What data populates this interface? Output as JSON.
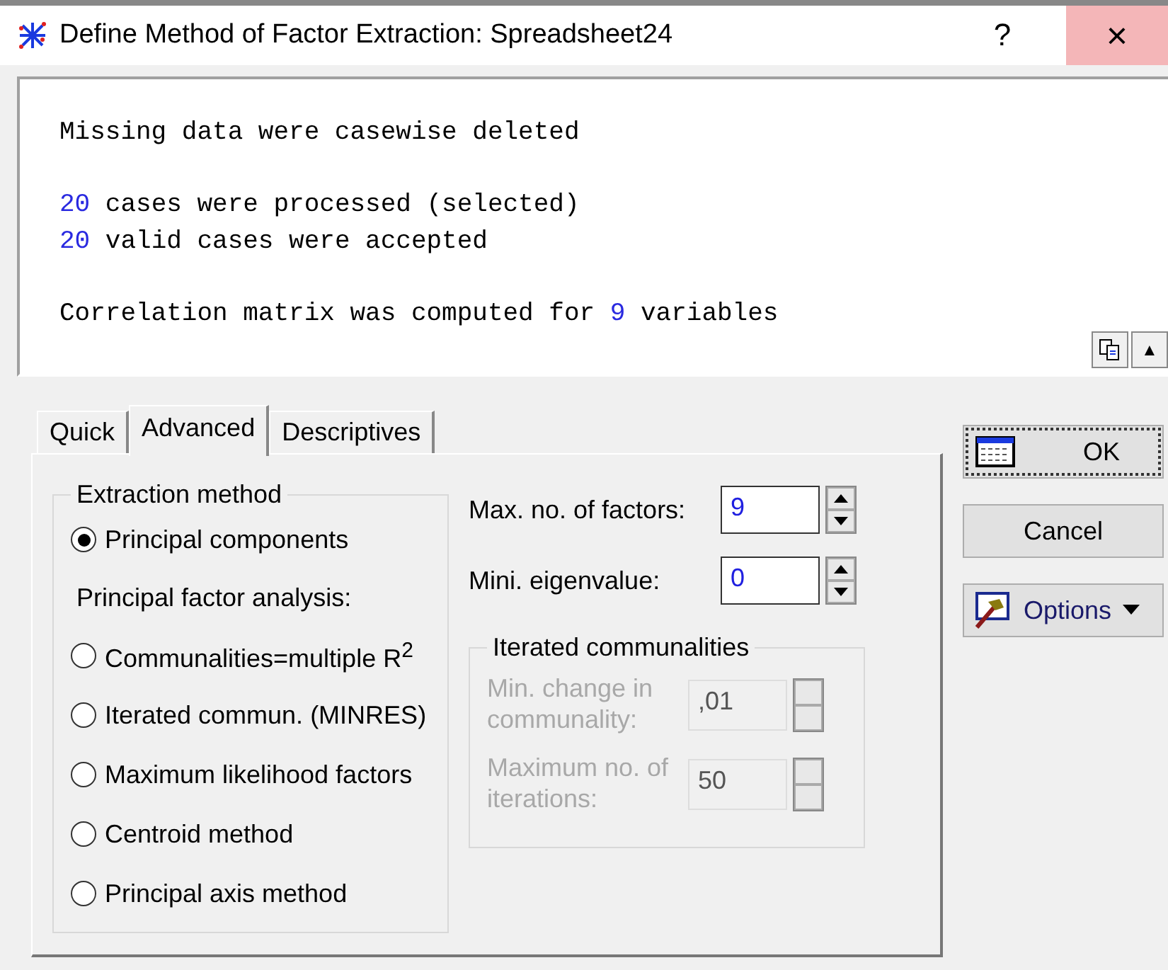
{
  "window": {
    "title": "Define Method of Factor Extraction: Spreadsheet24",
    "help": "?",
    "close": "×"
  },
  "output": {
    "lines": [
      {
        "kind": "text",
        "segments": [
          {
            "kind": "text",
            "text": "Missing data were casewise deleted"
          }
        ]
      },
      {
        "kind": "blank"
      },
      {
        "kind": "text",
        "segments": [
          {
            "kind": "number",
            "text": "20"
          },
          {
            "kind": "text",
            "text": " cases were processed (selected)"
          }
        ]
      },
      {
        "kind": "text",
        "segments": [
          {
            "kind": "number",
            "text": "20"
          },
          {
            "kind": "text",
            "text": " valid cases were accepted"
          }
        ]
      },
      {
        "kind": "blank"
      },
      {
        "kind": "text",
        "segments": [
          {
            "kind": "text",
            "text": "Correlation matrix was computed for "
          },
          {
            "kind": "number",
            "text": "9"
          },
          {
            "kind": "text",
            "text": " variables"
          }
        ]
      }
    ],
    "collapse": "▲"
  },
  "tabs": [
    {
      "label": "Quick",
      "selected": false
    },
    {
      "label": "Advanced",
      "selected": true
    },
    {
      "label": "Descriptives",
      "selected": false
    }
  ],
  "extraction": {
    "title": "Extraction method",
    "options": [
      {
        "kind": "radio",
        "label": "Principal components",
        "selected": true
      },
      {
        "kind": "heading",
        "label": "Principal factor analysis:"
      },
      {
        "kind": "radio",
        "label": "Communalities=multiple R$^{2}$",
        "selected": false
      },
      {
        "kind": "radio",
        "label": "Iterated commun. (MINRES)",
        "selected": false
      },
      {
        "kind": "radio",
        "label": "Maximum likelihood factors",
        "selected": false
      },
      {
        "kind": "radio",
        "label": "Centroid method",
        "selected": false
      },
      {
        "kind": "radio",
        "label": "Principal axis method",
        "selected": false
      }
    ]
  },
  "fields": [
    {
      "label": "Max. no. of factors:",
      "value": "9"
    },
    {
      "label": "Mini. eigenvalue:",
      "value": "0"
    }
  ],
  "iterated": {
    "title": "Iterated communalities",
    "disabled": true,
    "fields": [
      {
        "label": "Min. change in communality:",
        "value": ",01"
      },
      {
        "label": "Maximum no. of iterations:",
        "value": "50"
      }
    ]
  },
  "buttons": [
    {
      "kind": "ok",
      "label": "OK"
    },
    {
      "kind": "cancel",
      "label": "Cancel"
    },
    {
      "kind": "options",
      "label": "Options"
    }
  ]
}
